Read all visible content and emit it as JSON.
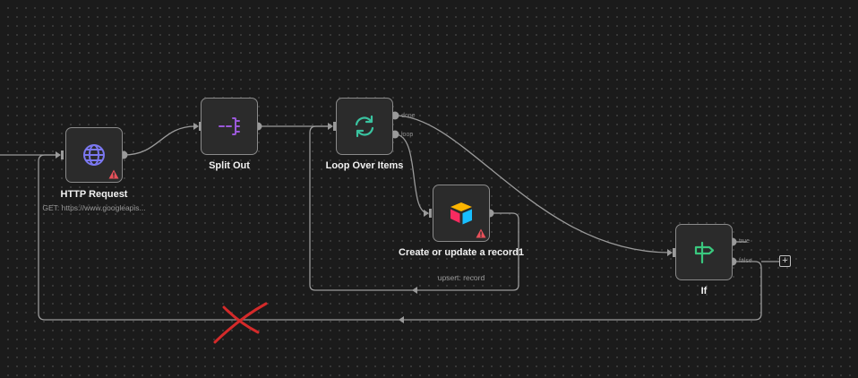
{
  "canvas": {
    "background": "#1b1b1b",
    "dot_color": "#3e3e3e"
  },
  "nodes": {
    "http_request": {
      "title": "HTTP Request",
      "subtitle": "GET: https://www.googleapis...",
      "icon": "globe-icon",
      "icon_color": "#7b78f0",
      "has_warning": true
    },
    "split_out": {
      "title": "Split Out",
      "icon": "split-out-icon",
      "icon_color": "#9b59d9"
    },
    "loop_over_items": {
      "title": "Loop Over Items",
      "icon": "loop-icon",
      "icon_color": "#3ac3a0",
      "outputs": [
        "done",
        "loop"
      ]
    },
    "airtable": {
      "title": "Create or update a record1",
      "subtitle": "upsert: record",
      "icon": "airtable-icon",
      "has_warning": true
    },
    "if": {
      "title": "If",
      "icon": "signpost-icon",
      "icon_color": "#3ac87e",
      "outputs": [
        "true",
        "false"
      ]
    }
  },
  "add_button": {
    "label": "+"
  },
  "annotation": {
    "deleted_connection_mark": "red-x-mark",
    "color": "#d42a2a"
  },
  "colors": {
    "edge": "#9a9a9a",
    "warning": "#e9515a"
  }
}
